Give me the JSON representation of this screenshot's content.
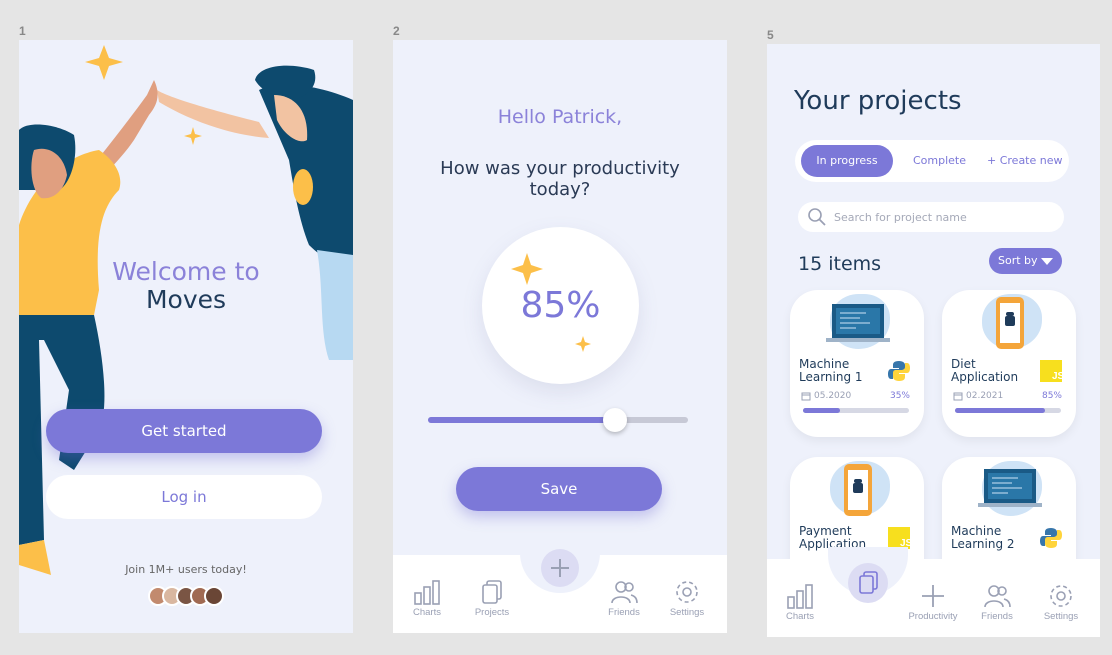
{
  "frames": {
    "f1": "1",
    "f2": "2",
    "f5": "5"
  },
  "screen1": {
    "welcome_line1": "Welcome to",
    "welcome_line2": "Moves",
    "get_started": "Get started",
    "login": "Log in",
    "join_text": "Join 1M+ users today!"
  },
  "screen2": {
    "greeting": "Hello Patrick,",
    "question": "How was your productivity today?",
    "value_label": "85%",
    "value": 0.72,
    "save": "Save",
    "tabs": {
      "charts": "Charts",
      "projects": "Projects",
      "friends": "Friends",
      "settings": "Settings"
    }
  },
  "screen5": {
    "title": "Your projects",
    "segments": {
      "active": "In progress",
      "complete": "Complete",
      "create": "+ Create new"
    },
    "search_placeholder": "Search for project name",
    "items_count": "15 items",
    "sort_by": "Sort by",
    "cards": [
      {
        "name": "Machine Learning 1",
        "date": "05.2020",
        "pct": "35%",
        "progress": 0.35,
        "lang": "python"
      },
      {
        "name": "Diet Application",
        "date": "02.2021",
        "pct": "85%",
        "progress": 0.85,
        "lang": "js"
      },
      {
        "name": "Payment Application",
        "lang": "js"
      },
      {
        "name": "Machine Learning 2",
        "lang": "python"
      }
    ],
    "tabs": {
      "charts": "Charts",
      "productivity": "Productivity",
      "friends": "Friends",
      "settings": "Settings"
    }
  },
  "colors": {
    "accent": "#7c78d8",
    "navy": "#1f3b5a",
    "screen_bg": "#eef1fb",
    "yellow": "#fcbf49"
  }
}
